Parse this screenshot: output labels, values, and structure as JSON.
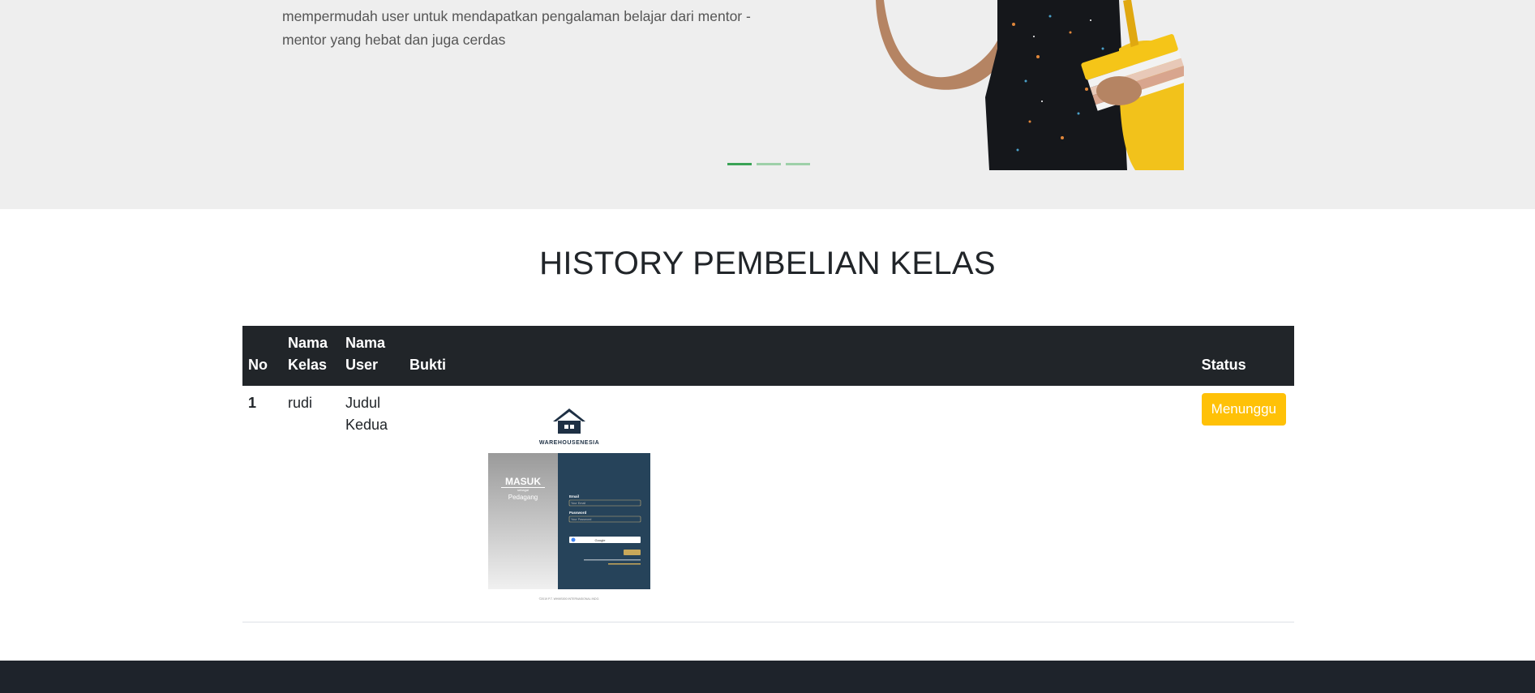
{
  "hero": {
    "text": "mempermudah user untuk mendapatkan pengalaman belajar dari mentor - mentor yang hebat dan juga cerdas",
    "carousel_slides": 3,
    "active_slide": 1
  },
  "section": {
    "title": "HISTORY PEMBELIAN KELAS"
  },
  "table": {
    "headers": {
      "no": "No",
      "nama_kelas": "Nama Kelas",
      "nama_user": "Nama User",
      "bukti": "Bukti",
      "status": "Status"
    },
    "rows": [
      {
        "no": "1",
        "nama_kelas": "rudi",
        "nama_user": "Judul Kedua",
        "bukti": {
          "brand": "WAREHOUSENESIA",
          "panel_title": "MASUK",
          "panel_sub": "sebagai",
          "panel_role": "Pedagang",
          "email_label": "Email",
          "email_placeholder": "Your Email",
          "password_label": "Password",
          "password_placeholder": "Your Password",
          "google_label": "Google",
          "copyright": "©2019 P.T. WHMS000 INTERNASIONAL INDO."
        },
        "status": "Menunggu"
      }
    ]
  },
  "colors": {
    "hero_bg": "#eeeeee",
    "table_header_bg": "#212529",
    "status_pending": "#ffc107",
    "carousel_active": "#3aa356",
    "footer_bg": "#1e232b"
  }
}
